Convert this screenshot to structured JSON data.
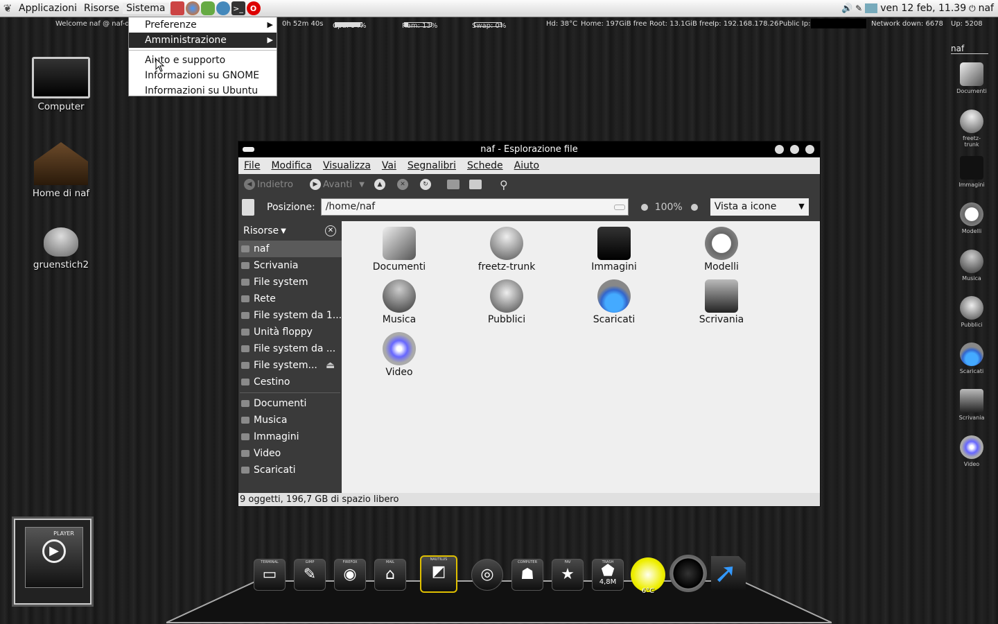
{
  "topbar": {
    "menus": [
      "Applicazioni",
      "Risorse",
      "Sistema"
    ],
    "clock": "ven 12 feb, 11.39",
    "user": "naf"
  },
  "conky": {
    "welcome": "Welcome naf @ naf-de",
    "uptime": "0h 52m 40s",
    "cpu_label": "Cpu: 94%",
    "cpu": 0.94,
    "ram_label": "Ram: 13%",
    "ram": 0.13,
    "swap_label": "Swap: 0%",
    "swap": 0.0,
    "hd": "Hd: 38°C",
    "home": "Home: 197GiB free",
    "root": "Root: 13.1GiB free",
    "ip": "Ip: 192.168.178.26",
    "public_ip": "Public Ip:",
    "netdown": "Network down: 6678",
    "up": "Up: 5208"
  },
  "sysmenu": {
    "items": [
      "Preferenze",
      "Amministrazione",
      "Aiuto e supporto",
      "Informazioni su GNOME",
      "Informazioni su Ubuntu"
    ]
  },
  "desktop": {
    "icons": [
      "Computer",
      "Home di naf",
      "gruenstich2"
    ]
  },
  "window": {
    "title": "naf - Esplorazione file",
    "menus": [
      "File",
      "Modifica",
      "Visualizza",
      "Vai",
      "Segnalibri",
      "Schede",
      "Aiuto"
    ],
    "back": "Indietro",
    "forward": "Avanti",
    "location_label": "Posizione:",
    "location": "/home/naf",
    "zoom": "100%",
    "view": "Vista a icone",
    "status": "9 oggetti, 196,7 GB di spazio libero"
  },
  "sidebar": {
    "header": "Risorse",
    "places": [
      "naf",
      "Scrivania",
      "File system",
      "Rete",
      "File system da 1...",
      "Unità floppy",
      "File system da ...",
      "File system...",
      "Cestino"
    ],
    "bookmarks": [
      "Documenti",
      "Musica",
      "Immagini",
      "Video",
      "Scaricati"
    ]
  },
  "files": [
    "Documenti",
    "freetz-trunk",
    "Immagini",
    "Modelli",
    "Musica",
    "Pubblici",
    "Scaricati",
    "Scrivania",
    "Video"
  ],
  "right": {
    "user": "naf",
    "items": [
      "Documenti",
      "freetz-trunk",
      "Immagini",
      "Modelli",
      "Musica",
      "Pubblici",
      "Scaricati",
      "Scrivania",
      "Video"
    ]
  },
  "player": {
    "label": "PLAYER"
  },
  "dock": {
    "labels": [
      "TERMINAL",
      "GIMP",
      "FIREFOX",
      "MAIL",
      "NAUTILUS",
      "",
      "COMPUTER",
      "FAV",
      "TRASH"
    ],
    "trash_size": "4,8M",
    "weather": "6°C"
  }
}
